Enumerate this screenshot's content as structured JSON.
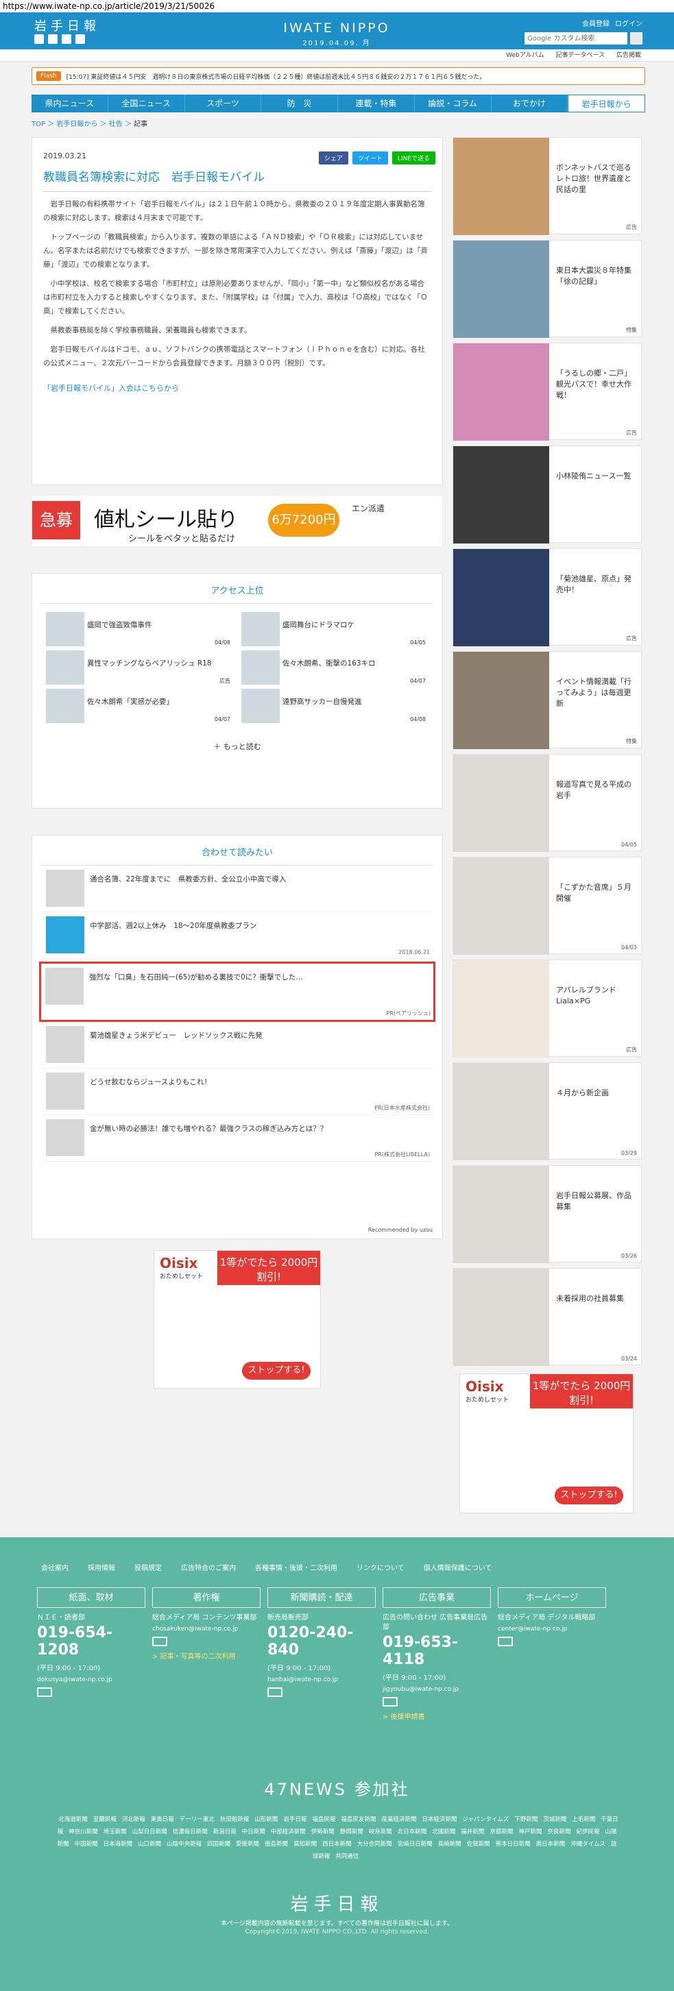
{
  "url": "https://www.iwate-np.co.jp/article/2019/3/21/50026",
  "header": {
    "logo_left": "岩手日報",
    "logo_center": "IWATE NIPPO",
    "date": "2019.04.09. 月",
    "member_reg": "会員登録",
    "login": "ログイン",
    "search_placeholder": "Google カスタム検索"
  },
  "subbar": [
    "Webアルバム",
    "記事データベース",
    "広告掲載"
  ],
  "flash": {
    "label": "Flash",
    "text": "[15:07] 東証終値は４５円安　週明け８日の東京株式市場の日経平均株価（２２５種）終値は前週末比４５円８６銭安の２万１７６１円６５銭だった。"
  },
  "nav": [
    "県内ニュース",
    "全国ニュース",
    "スポーツ",
    "防　災",
    "連載・特集",
    "論説・コラム",
    "おでかけ",
    "岩手日報から"
  ],
  "breadcrumb": {
    "top": "TOP",
    "sep": "＞",
    "a": "岩手日報から",
    "b": "社告",
    "current": "記事"
  },
  "article": {
    "date": "2019.03.21",
    "share": [
      "シェア",
      "ツイート",
      "LINEで送る"
    ],
    "title": "教職員名簿検索に対応　岩手日報モバイル",
    "paras": [
      "岩手日報の有料携帯サイト「岩手日報モバイル」は２１日午前１０時から、県教委の２０１９年度定期人事異動名簿の検索に対応します。検索は４月末まで可能です。",
      "トップページの「教職員検索」から入ります。複数の単語による「ＡＮＤ検索」や「ＯＲ検索」には対応していません。名字または名前だけでも検索できますが、一部を除き常用漢字で入力してください。例えば「斎藤」「渡辺」は「斉藤」「渡辺」での検索となります。",
      "小中学校は、校名で検索する場合「市町村立」は原則必要ありませんが、「岡小」「第一中」など類似校名がある場合は市町村立を入力すると検索しやすくなります。また、「附属学校」は「付属」で入力、高校は「Ｏ高校」ではなく「Ｏ高」で検索してください。",
      "県教委事務局を除く学校事務職員、栄養職員も検索できます。",
      "岩手日報モバイルはドコモ、ａｕ、ソフトバンクの携帯電話とスマートフォン（ｉＰｈｏｎｅを含む）に対応。各社の公式メニュー、２次元バーコードから会員登録できます。月額３００円（税別）です。"
    ],
    "link": "「岩手日報モバイル」入会はこちらから"
  },
  "ad_banner": {
    "tag": "急募",
    "main": "値札シール貼り",
    "sub": "シールをペタッと貼るだけ",
    "price": "6万7200円",
    "days": "7日間で",
    "brand": "エン派遣"
  },
  "ranking": {
    "heading": "アクセス上位",
    "items": [
      {
        "title": "盛岡で強盗致傷事件",
        "date": "04/08"
      },
      {
        "title": "盛岡舞台にドラマロケ",
        "date": "04/05"
      },
      {
        "title": "異性マッチングならペアリッシュ R18",
        "date": "広告"
      },
      {
        "title": "佐々木朗希、衝撃の163キロ",
        "date": "04/07"
      },
      {
        "title": "佐々木朗希「実感が必要」",
        "date": "04/07"
      },
      {
        "title": "遠野高サッカー自慢発進",
        "date": "04/08"
      }
    ],
    "more": "もっと読む"
  },
  "related": {
    "heading": "合わせて読みたい",
    "items": [
      {
        "title": "通合名簿、22年度までに　県教委方針、全公立小中高で導入",
        "sub": ""
      },
      {
        "title": "中学部活、週2以上休み　18〜20年度県教委プラン",
        "sub": "2018.06.21"
      },
      {
        "title": "強烈な「口臭」を石田純一(65)が勧める裏技で0に？衝撃でした…",
        "sub": "PR(ペアリッシュ)"
      },
      {
        "title": "菊池雄星きょう米デビュー　レッドソックス戦に先発",
        "sub": ""
      },
      {
        "title": "どうせ飲むならジュースよりもこれ！",
        "sub": "PR(日本水産株式会社)"
      },
      {
        "title": "金が無い時の必勝法！誰でも増やれる？最強クラスの稼ぎ込み方とは？？",
        "sub": "PR(株式会社LIBELLA)"
      }
    ],
    "recommended": "Recommended by uzou"
  },
  "oisix": {
    "brand": "Oisix",
    "sub": "おためしセット",
    "top": "1等がでたら 2000円割引!",
    "btn": "ストップする!"
  },
  "sidebar": [
    {
      "title": "ボンネットバスで巡るレトロ旅！世界遺産と民話の里",
      "tag": "広告"
    },
    {
      "title": "東日本大震災８年特集「徐の記録」",
      "tag": "特集"
    },
    {
      "title": "「うるしの郷・二戸」観光バスで！幸せ大作戦！",
      "tag": "広告"
    },
    {
      "title": "小林陵侑ニュース一覧",
      "tag": ""
    },
    {
      "title": "「菊池雄星、原点」発売中！",
      "tag": "広告"
    },
    {
      "title": "イベント情報満載「行ってみよう」は毎週更新",
      "tag": "特集"
    },
    {
      "title": "報道写真で見る平成の岩手",
      "tag": "04/05"
    },
    {
      "title": "「こずかた音席」５月開催",
      "tag": "04/03"
    },
    {
      "title": "アパレルブランド Liala×PG",
      "tag": "広告"
    },
    {
      "title": "４月から新企画",
      "tag": "03/29"
    },
    {
      "title": "岩手日報公募展、作品募集",
      "tag": "03/26"
    },
    {
      "title": "未着採用の社員募集",
      "tag": "03/24"
    }
  ],
  "footer": {
    "links": [
      "会社案内",
      "採用情報",
      "投稿規定",
      "広告特合のご案内",
      "各種事情・後援・二次利用",
      "リンクについて",
      "個人情報保護について"
    ],
    "cols": [
      {
        "box": "紙面、取材",
        "dept": "ＮＩＥ・読者部",
        "phone": "019-654-1208",
        "hours": "(平日 9:00 - 17:00)",
        "email": "dokusya@iwate-np.co.jp",
        "extra": ""
      },
      {
        "box": "著作権",
        "dept": "総合メディア局 コンテンツ事業部",
        "phone": "",
        "hours": "",
        "email": "chosakuken@iwate-np.co.jp",
        "extra": "> 記事・写真等の二次利用"
      },
      {
        "box": "新聞購読・配達",
        "dept": "販売局販売部",
        "phone": "0120-240-840",
        "hours": "(平日 9:00 - 17:00)",
        "email": "hanbai@iwate-np.co.jp",
        "extra": ""
      },
      {
        "box": "広告事業",
        "dept": "広告の問い合わせ 広告事業局広告部",
        "phone": "019-653-4118",
        "hours": "(平日 9:00 - 17:00)",
        "email": "jigyoubu@iwate-np.co.jp",
        "extra": "> 後援申請書"
      },
      {
        "box": "ホームページ",
        "dept": "総合メディア局 デジタル戦略部",
        "phone": "",
        "hours": "",
        "email": "center@iwate-np.co.jp",
        "extra": ""
      }
    ],
    "n47": "47NEWS 参加社",
    "papers": [
      "北海道新聞",
      "室蘭民報",
      "河北新報",
      "東奥日報",
      "デーリー東北",
      "秋田魁新報",
      "山形新聞",
      "岩手日報",
      "福島民報",
      "福島民友新聞",
      "産業経済新聞",
      "日本経済新聞",
      "ジャパンタイムズ",
      "下野新聞",
      "茨城新聞",
      "上毛新聞",
      "千葉日報",
      "神奈川新聞",
      "埼玉新聞",
      "山梨日日新聞",
      "信濃毎日新聞",
      "新潟日報",
      "中日新聞",
      "中部経済新聞",
      "伊勢新聞",
      "静岡新聞",
      "岐阜新聞",
      "北日本新聞",
      "北國新聞",
      "福井新聞",
      "京都新聞",
      "神戸新聞",
      "奈良新聞",
      "紀伊民報",
      "山陽新聞",
      "中国新聞",
      "日本海新聞",
      "山口新聞",
      "山陰中央新報",
      "四国新聞",
      "愛媛新聞",
      "徳島新聞",
      "高知新聞",
      "西日本新聞",
      "大分合同新聞",
      "宮崎日日新聞",
      "長崎新聞",
      "佐賀新聞",
      "熊本日日新聞",
      "南日本新聞",
      "沖縄タイムス",
      "琉球新報",
      "共同通信"
    ],
    "logo": "岩手日報",
    "note": "本ページ掲載内容の無断転載を禁じます。すべての著作権は岩手日報社に属します。",
    "copy": "Copyright©2019, IWATE NIPPO CO.,LTD. All rights reserved."
  }
}
